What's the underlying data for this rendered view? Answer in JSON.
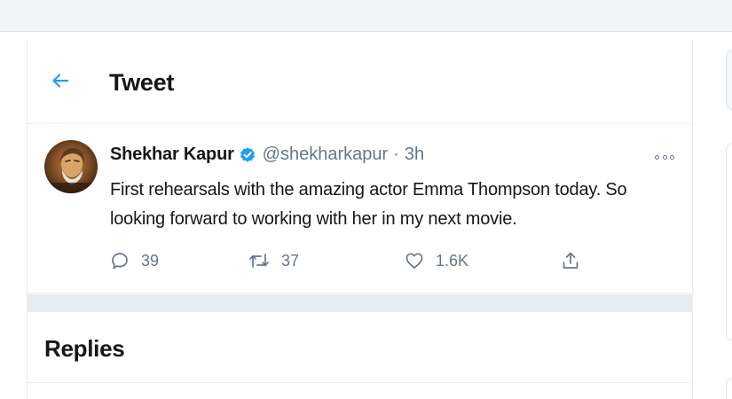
{
  "header": {
    "back_icon": "arrow-left-icon",
    "title": "Tweet"
  },
  "tweet": {
    "author_name": "Shekhar Kapur",
    "verified": true,
    "handle": "@shekharkapur",
    "separator": "·",
    "time": "3h",
    "text": "First rehearsals with the amazing actor Emma Thompson today. So looking forward to working with her in my next movie.",
    "actions": {
      "reply_count": "39",
      "retweet_count": "37",
      "like_count": "1.6K"
    }
  },
  "replies": {
    "title": "Replies"
  },
  "colors": {
    "accent": "#1da1f2",
    "muted_text": "#657786",
    "border": "#e6ecf0"
  }
}
